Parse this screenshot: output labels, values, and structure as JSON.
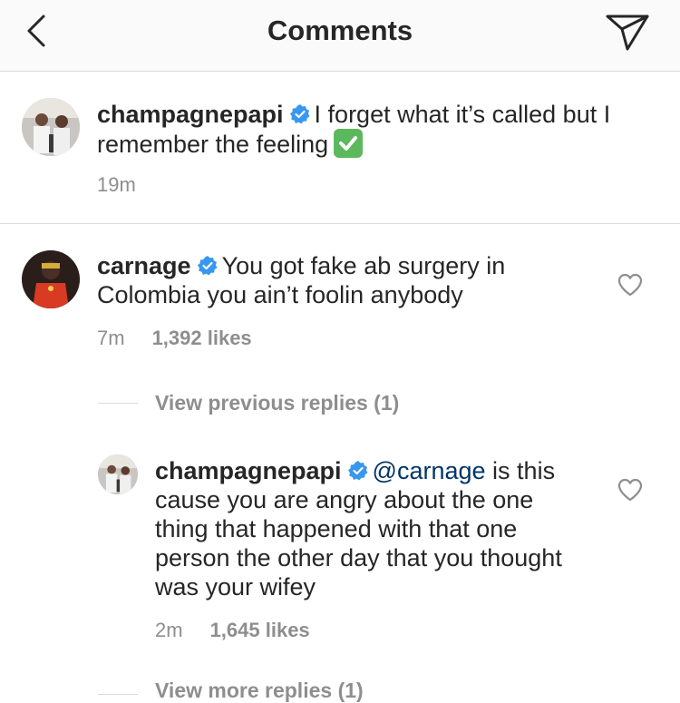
{
  "header": {
    "title": "Comments",
    "back_icon": "chevron-left-icon",
    "send_icon": "paper-plane-icon"
  },
  "caption": {
    "username": "champagnepapi",
    "text": "I forget what it’s called but I remember the feeling",
    "emoji": "white-check-mark-emoji",
    "time": "19m"
  },
  "comments": [
    {
      "username": "carnage",
      "text": "You got fake ab surgery in Colombia you ain’t foolin anybody",
      "time": "7m",
      "likes": "1,392 likes",
      "view_previous_replies": "View previous replies (1)",
      "replies": [
        {
          "username": "champagnepapi",
          "mention": "@carnage",
          "text": "is this cause you are angry about the one thing that happened with that one person the other day that you thought was your wifey",
          "time": "2m",
          "likes": "1,645 likes"
        }
      ],
      "view_more_replies": "View more replies (1)"
    }
  ],
  "colors": {
    "verified": "#3897f0",
    "mention": "#003569",
    "secondary_text": "#8e8e8e",
    "divider": "#dbdbdb",
    "check_emoji": "#5cb85c"
  }
}
